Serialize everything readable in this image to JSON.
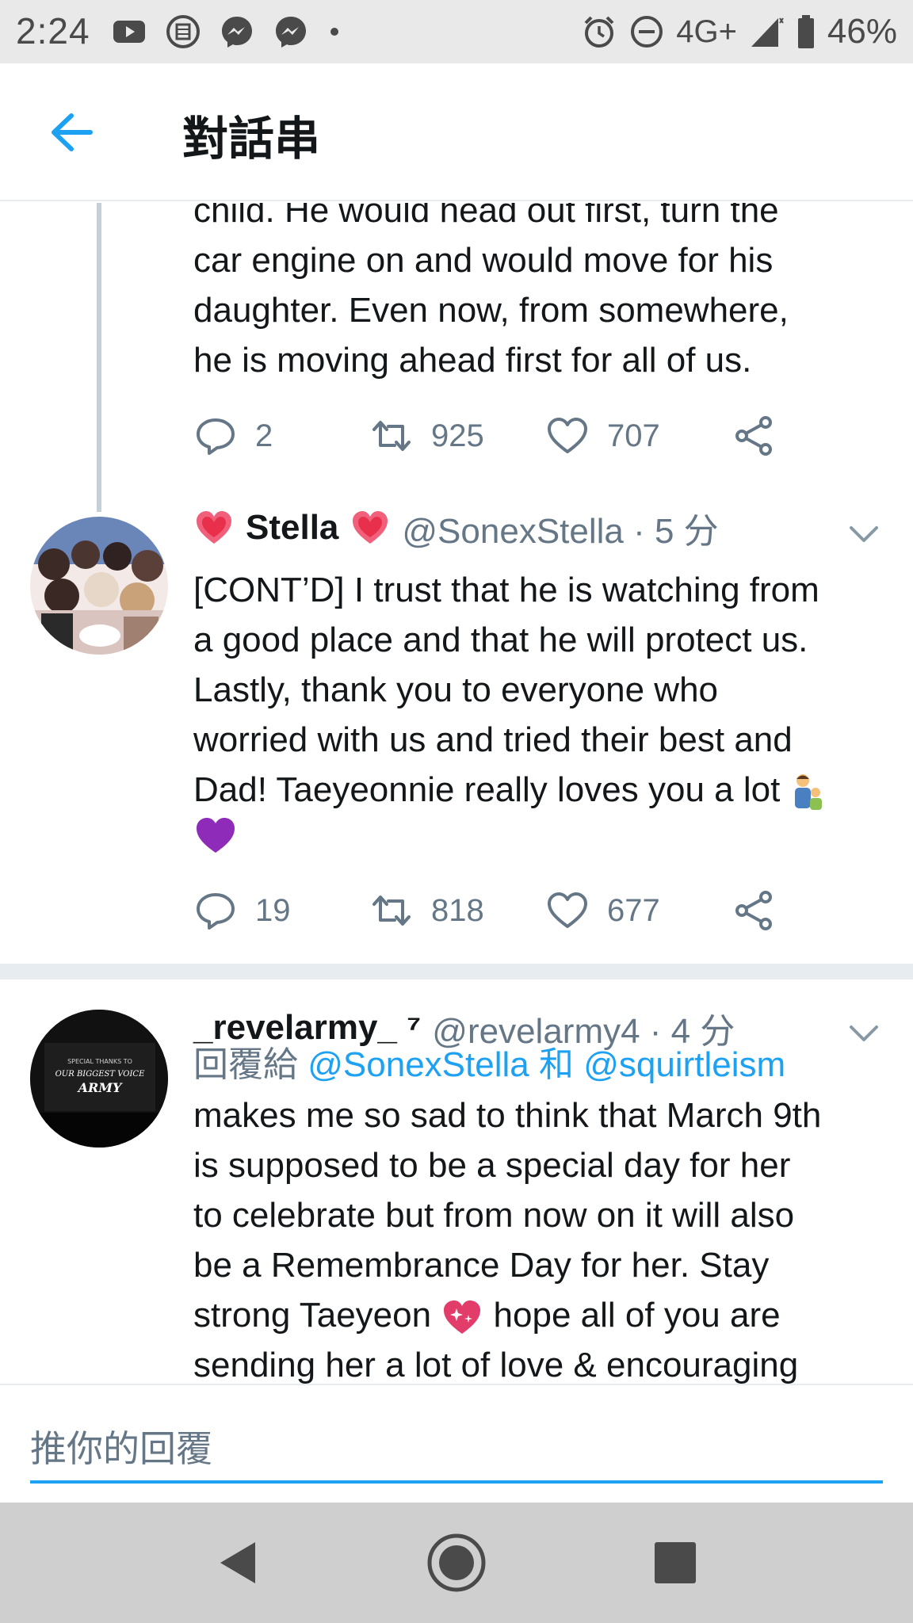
{
  "status_bar": {
    "time": "2:24",
    "network": "4G+",
    "battery": "46%"
  },
  "header": {
    "title": "對話串"
  },
  "tweet_prev": {
    "text_lines": [
      "child. He would head out first, turn the",
      "car engine on and would move for his",
      "daughter. Even now, from somewhere,",
      "he is moving ahead first for all of us."
    ],
    "replies": "2",
    "retweets": "925",
    "likes": "707"
  },
  "tweet_stella": {
    "name": "Stella",
    "handle": "@SonexStella · 5 分",
    "text_lines": [
      "[CONT’D] I trust that he is watching from",
      "a good place and that he will protect us.",
      "Lastly, thank you to everyone who",
      "worried with us and tried their best and",
      "Dad! Taeyeonnie really loves you a lot"
    ],
    "replies": "19",
    "retweets": "818",
    "likes": "677"
  },
  "tweet_revel": {
    "name": "_revelarmy_ ⁷",
    "handle": "@revelarmy4 · 4 分",
    "reply_prefix": "回覆給",
    "reply_to_1": "@SonexStella",
    "reply_and": "和",
    "reply_to_2": "@squirtleism",
    "avatar_text_1": "SPECIAL THANKS TO",
    "avatar_text_2": "OUR BIGGEST VOICE",
    "avatar_text_3": "ARMY",
    "text_lines": [
      "makes me so sad to think that March 9th",
      "is supposed to be a special day for her",
      "to celebrate but from now on it will also",
      "be a Remembrance Day for her. Stay",
      "strong Taeyeon",
      "hope all of you are",
      "sending her a lot of love & encouraging"
    ]
  },
  "reply_bar": {
    "placeholder": "推你的回覆"
  },
  "colors": {
    "accent": "#1da1f2",
    "secondary_text": "#657786",
    "divider": "#e6ecf0"
  },
  "icons": [
    "youtube-icon",
    "messenger-icon",
    "alarm-icon",
    "dnd-icon",
    "signal-icon",
    "battery-icon",
    "back-arrow-icon",
    "reply-icon",
    "retweet-icon",
    "like-icon",
    "share-icon",
    "chevron-down-icon",
    "heart-emoji-icon",
    "purple-heart-emoji-icon",
    "family-emoji-icon",
    "sparkling-heart-emoji-icon"
  ]
}
